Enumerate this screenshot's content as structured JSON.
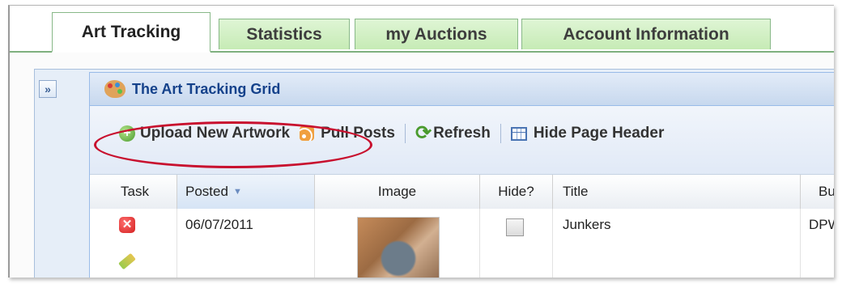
{
  "tabs": [
    {
      "label": "Art Tracking",
      "active": true
    },
    {
      "label": "Statistics",
      "active": false
    },
    {
      "label": "my Auctions",
      "active": false
    },
    {
      "label": "Account Information",
      "active": false
    }
  ],
  "expander_glyph": "»",
  "panel": {
    "title": "The Art Tracking Grid",
    "icon": "palette-icon"
  },
  "toolbar": {
    "upload_label": "Upload New Artwork",
    "pull_label": "Pull Posts",
    "refresh_label": "Refresh",
    "hide_header_label": "Hide Page Header"
  },
  "grid": {
    "columns": [
      "Task",
      "Posted",
      "Image",
      "Hide?",
      "Title",
      "Buy"
    ],
    "sorted_column": "Posted",
    "rows": [
      {
        "posted": "06/07/2011",
        "hidden": false,
        "title": "Junkers",
        "buyer": "DPW"
      }
    ]
  },
  "colors": {
    "tab_green": "#c6ebb5",
    "panel_blue": "#15428b",
    "highlight_red": "#c8102e"
  }
}
